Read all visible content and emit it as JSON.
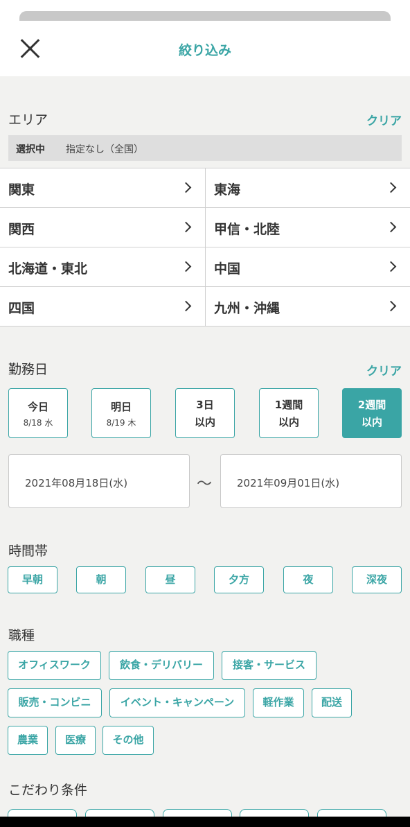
{
  "header": {
    "title": "絞り込み"
  },
  "area": {
    "label": "エリア",
    "clear": "クリア",
    "selected_key": "選択中",
    "selected_value": "指定なし（全国）",
    "cells": [
      "関東",
      "東海",
      "関西",
      "甲信・北陸",
      "北海道・東北",
      "中国",
      "四国",
      "九州・沖縄"
    ]
  },
  "work_day": {
    "label": "勤務日",
    "clear": "クリア",
    "options": [
      {
        "line1": "今日",
        "line2": "8/18 水"
      },
      {
        "line1": "明日",
        "line2": "8/19 木"
      },
      {
        "line1": "3日",
        "line2": "以内"
      },
      {
        "line1": "1週間",
        "line2": "以内"
      },
      {
        "line1": "2週間",
        "line2": "以内",
        "selected": true
      }
    ],
    "start_date": "2021年08月18日(水)",
    "separator": "〜",
    "end_date": "2021年09月01日(水)"
  },
  "time_band": {
    "label": "時間帯",
    "options": [
      "早朝",
      "朝",
      "昼",
      "夕方",
      "夜",
      "深夜"
    ]
  },
  "job_type": {
    "label": "職種",
    "options": [
      "オフィスワーク",
      "飲食・デリバリー",
      "接客・サービス",
      "販売・コンビニ",
      "イベント・キャンペーン",
      "軽作業",
      "配送",
      "農業",
      "医療",
      "その他"
    ]
  },
  "preferences": {
    "label": "こだわり条件"
  },
  "colors": {
    "accent": "#3aa5a5",
    "background": "#f2f2f0",
    "text": "#333333"
  }
}
